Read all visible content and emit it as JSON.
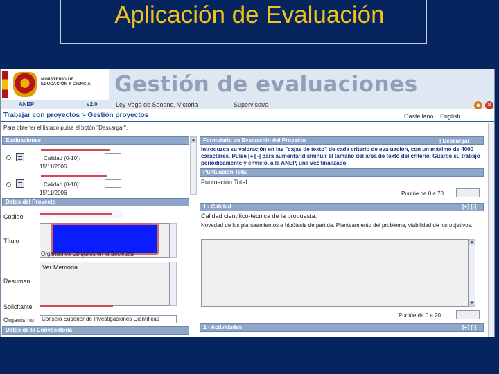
{
  "slide": {
    "title": "Aplicación de Evaluación"
  },
  "header": {
    "ministerio": "MINISTERIO DE EDUCACIÓN Y CIENCIA",
    "agency": "ANEP",
    "version": "v2.0",
    "app_title": "Gestión de evaluaciones",
    "user_name": "Ley Vega de Seoane, Victoria",
    "user_role": "Supervisor/a"
  },
  "nav": {
    "breadcrumb": "Trabajar con proyectos > Gestión proyectos",
    "lang_es": "Castellano",
    "lang_en": "English",
    "hint": "Para obtener el listado pulse el botón \"Descargar\"."
  },
  "left": {
    "evaluaciones": {
      "header": "Evaluaciones",
      "items": [
        {
          "label": "Calidad (0-10):",
          "date": "15/11/2006"
        },
        {
          "label": "Calidad (0-10):",
          "date": "15/11/2006"
        }
      ]
    },
    "datos_proyecto": {
      "header": "Datos del Proyecto",
      "codigo_label": "Código",
      "titulo_label": "Título",
      "titulo_visible_fragment": "Organismos Ubiquitos en la Sociedad",
      "resumen_label": "Resumen",
      "resumen_value": "Ver Memoria",
      "solicitante_label": "Solicitante",
      "organismo_label": "Organismo",
      "organismo_value": "Consejo Superior de Investigaciones Científicas"
    },
    "convocatoria": {
      "header": "Datos de la Convocatoria"
    }
  },
  "right": {
    "formulario": {
      "header": "Formulario de Evaluación del Proyecto",
      "descargar": "| Descargar",
      "instructions": "Introduzca su valoración en las \"cajas de texto\" de cada criterio de evaluación, con un máximo de 4000 caracteres. Pulse [+][-] para aumentar/disminuir el tamaño del área de texto del criterio. Guarde su trabajo periódicamente y envíelo, a la ANEP, una vez finalizado."
    },
    "puntuacion_total": {
      "header": "Puntuación Total",
      "label": "Puntuación Total",
      "scale": "Puntúe de 0 a 70"
    },
    "calidad": {
      "header": "1.- Calidad",
      "toggle": "[+] [-]",
      "line1": "Calidad científico-técnica de la propuesta.",
      "line2": "Novedad de los planteamientos e hipótesis de partida. Planteamiento del problema, viabilidad de los objetivos.",
      "scale": "Puntúe de 0 a 20"
    },
    "actividades": {
      "header": "2.- Actividades",
      "toggle": "[+] [-]"
    }
  }
}
